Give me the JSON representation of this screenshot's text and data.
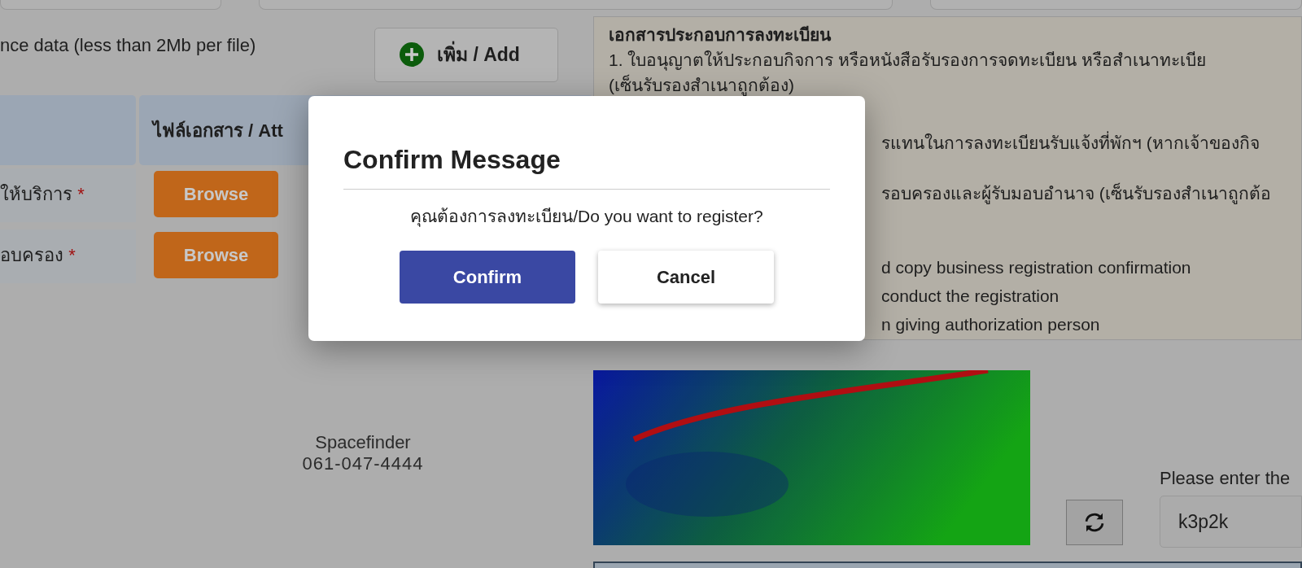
{
  "upload": {
    "note": "nce data (less than 2Mb per file)",
    "add_button": "เพิ่ม / Add"
  },
  "table": {
    "column_2": "ไฟล์เอกสาร / Att",
    "rows": [
      {
        "label": "ให้บริการ",
        "required_mark": "*",
        "button": "Browse"
      },
      {
        "label": "อบครอง",
        "required_mark": "*",
        "button": "Browse"
      }
    ]
  },
  "documents": {
    "title": "เอกสารประกอบการลงทะเบียน",
    "lines": [
      {
        "kind": "full",
        "text": "1. ใบอนุญาตให้ประกอบกิจการ หรือหนังสือรับรองการจดทะเบียน หรือสำเนาทะเบีย"
      },
      {
        "kind": "full",
        "text": "(เซ็นรับรองสำเนาถูกต้อง)"
      },
      {
        "kind": "covered",
        "text": "รแทนในการลงทะเบียนรับแจ้งที่พักฯ (หากเจ้าของกิจ"
      },
      {
        "kind": "covered",
        "text": "รอบครองและผู้รับมอบอำนาจ (เซ็นรับรองสำเนาถูกต้อ"
      },
      {
        "kind": "covered",
        "text": "d copy business registration confirmation"
      },
      {
        "kind": "covered",
        "text": "conduct the registration"
      },
      {
        "kind": "covered",
        "text": "n giving authorization person"
      }
    ]
  },
  "contact": {
    "name": "Spacefinder",
    "phone": "061-047-4444"
  },
  "captcha": {
    "kind": "picture",
    "prompt": "Please enter the",
    "value": "k3p2k"
  },
  "dialog": {
    "title": "Confirm Message",
    "message": "คุณต้องการลงทะเบียน/Do you want to register?",
    "buttons": [
      {
        "label": "Confirm",
        "kind": "primary"
      },
      {
        "label": "Cancel",
        "kind": "secondary"
      }
    ]
  }
}
